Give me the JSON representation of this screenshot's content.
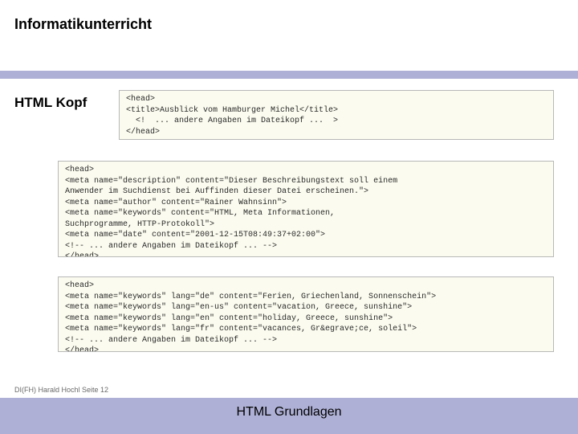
{
  "header": {
    "title": "Informatikunterricht"
  },
  "section": {
    "label": "HTML Kopf"
  },
  "code_blocks": {
    "block1": "<head>\n<title>Ausblick vom Hamburger Michel</title>\n  <!  ... andere Angaben im Dateikopf ...  >\n</head>",
    "block2": "<head>\n<meta name=\"description\" content=\"Dieser Beschreibungstext soll einem\nAnwender im Suchdienst bei Auffinden dieser Datei erscheinen.\">\n<meta name=\"author\" content=\"Rainer Wahnsinn\">\n<meta name=\"keywords\" content=\"HTML, Meta Informationen,\nSuchprogramme, HTTP-Protokoll\">\n<meta name=\"date\" content=\"2001-12-15T08:49:37+02:00\">\n<!-- ... andere Angaben im Dateikopf ... -->\n</head>",
    "block3": "<head>\n<meta name=\"keywords\" lang=\"de\" content=\"Ferien, Griechenland, Sonnenschein\">\n<meta name=\"keywords\" lang=\"en-us\" content=\"vacation, Greece, sunshine\">\n<meta name=\"keywords\" lang=\"en\" content=\"holiday, Greece, sunshine\">\n<meta name=\"keywords\" lang=\"fr\" content=\"vacances, Gr&egrave;ce, soleil\">\n<!-- ... andere Angaben im Dateikopf ... -->\n</head>"
  },
  "footer": {
    "credit": "DI(FH) Harald Hochl  Seite 12",
    "title": "HTML Grundlagen"
  }
}
